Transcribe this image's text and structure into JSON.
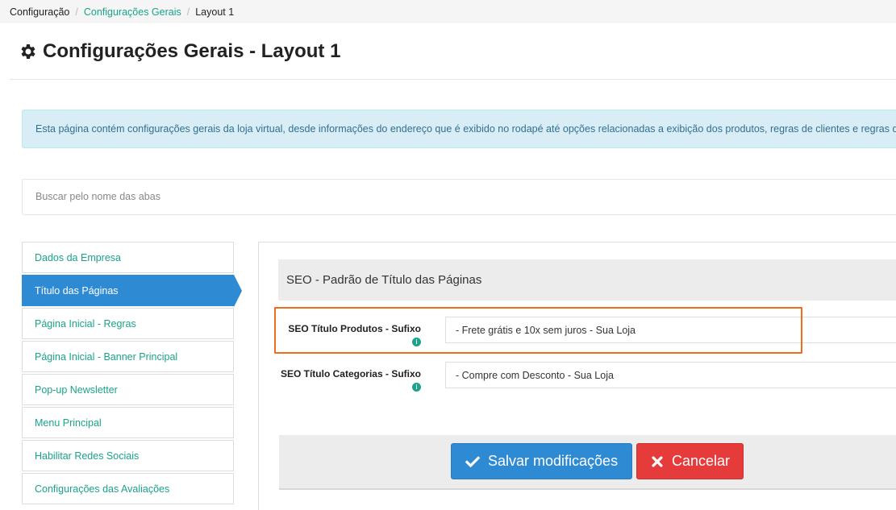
{
  "breadcrumb": {
    "items": [
      "Configuração",
      "Configurações Gerais",
      "Layout 1"
    ],
    "separator": "/"
  },
  "page": {
    "title": "Configurações Gerais - Layout 1",
    "title_icon": "gear-icon"
  },
  "info_message": "Esta página contém configurações gerais da loja virtual, desde informações do endereço que é exibido no rodapé até opções relacionadas a exibição dos produtos, regras de clientes e regras do carr",
  "search": {
    "placeholder": "Buscar pelo nome das abas",
    "value": ""
  },
  "sidebar": {
    "items": [
      {
        "label": "Dados da Empresa",
        "active": false
      },
      {
        "label": "Título das Páginas",
        "active": true
      },
      {
        "label": "Página Inicial - Regras",
        "active": false
      },
      {
        "label": "Página Inicial - Banner Principal",
        "active": false
      },
      {
        "label": "Pop-up Newsletter",
        "active": false
      },
      {
        "label": "Menu Principal",
        "active": false
      },
      {
        "label": "Habilitar Redes Sociais",
        "active": false
      },
      {
        "label": "Configurações das Avaliações",
        "active": false
      }
    ]
  },
  "section": {
    "title": "SEO - Padrão de Título das Páginas"
  },
  "fields": {
    "produtos": {
      "label": "SEO Título Produtos - Sufixo",
      "value": "- Frete grátis e 10x sem juros - Sua Loja",
      "info_icon": "i"
    },
    "categorias": {
      "label": "SEO Título Categorias - Sufixo",
      "value": "- Compre com Desconto - Sua Loja",
      "info_icon": "i"
    }
  },
  "actions": {
    "save_label": "Salvar modificações",
    "cancel_label": "Cancelar"
  },
  "colors": {
    "accent_teal": "#1aa38a",
    "primary_blue": "#2f8ad4",
    "danger_red": "#e53b3b",
    "highlight_orange": "#f26c1d"
  }
}
